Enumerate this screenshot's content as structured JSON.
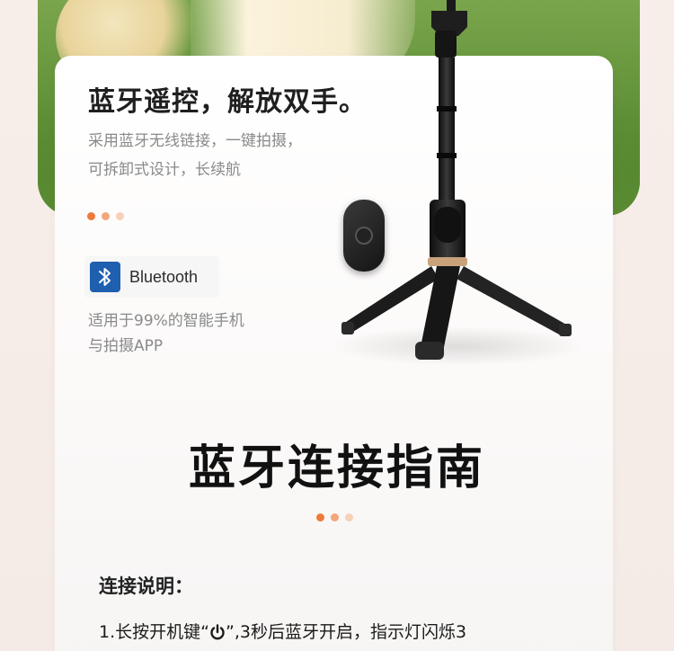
{
  "header": {
    "title": "蓝牙遥控，解放双手。",
    "subtitle_line1": "采用蓝牙无线链接，一键拍摄，",
    "subtitle_line2": "可拆卸式设计，长续航"
  },
  "bluetooth": {
    "label": "Bluetooth",
    "compat_line1": "适用于99%的智能手机",
    "compat_line2": "与拍摄APP"
  },
  "guide": {
    "title": "蓝牙连接指南",
    "section_heading": "连接说明：",
    "step1_prefix": "1.长按开机键“",
    "step1_suffix": "”,3秒后蓝牙开启，指示灯闪烁3"
  },
  "colors": {
    "accent": "#ee7a3a",
    "accent_mid": "#f2a77c",
    "accent_light": "#f7d0b8",
    "bluetooth_blue": "#1f5fb0"
  },
  "icons": {
    "bluetooth": "bluetooth-icon",
    "power": "power-icon",
    "remote": "remote-shutter-icon"
  }
}
